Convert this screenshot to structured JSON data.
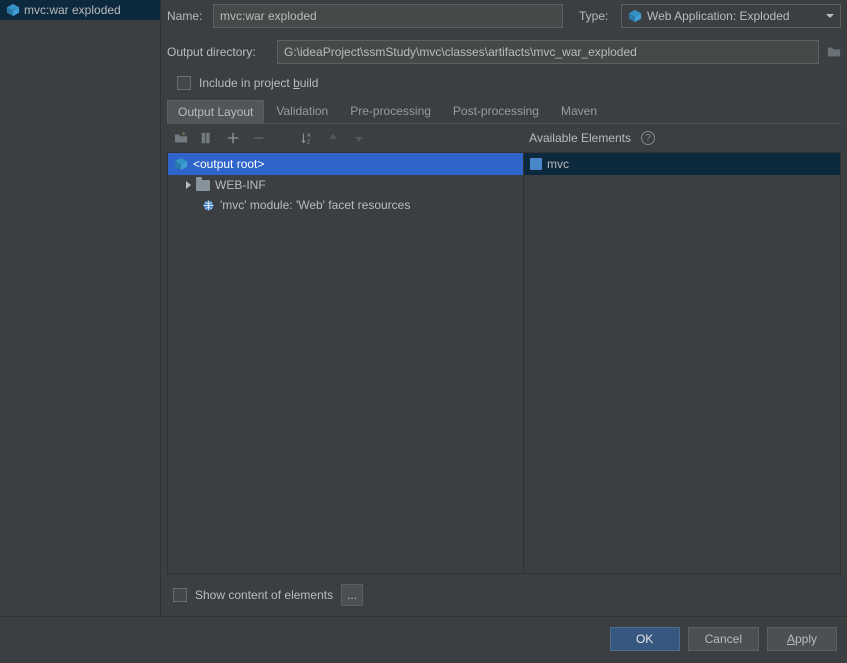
{
  "sidebar": {
    "artifact": "mvc:war exploded"
  },
  "form": {
    "name_label": "Name:",
    "name_value": "mvc:war exploded",
    "type_label": "Type:",
    "type_value": "Web Application: Exploded",
    "outdir_label": "Output directory:",
    "outdir_value": "G:\\ideaProject\\ssmStudy\\mvc\\classes\\artifacts\\mvc_war_exploded",
    "include_build_prefix": "Include in project ",
    "include_build_u": "b",
    "include_build_suffix": "uild"
  },
  "tabs": {
    "output_layout": "Output Layout",
    "validation": "Validation",
    "pre_processing": "Pre-processing",
    "post_processing": "Post-processing",
    "maven": "Maven"
  },
  "toolbar": {
    "available_label": "Available Elements"
  },
  "tree": {
    "root": "<output root>",
    "webinf": "WEB-INF",
    "web_facet": "'mvc' module: 'Web' facet resources"
  },
  "avail": {
    "mvc": "mvc"
  },
  "bottom": {
    "show_content": "Show content of elements",
    "dots": "..."
  },
  "buttons": {
    "ok": "OK",
    "cancel": "Cancel",
    "apply_u": "A",
    "apply_rest": "pply"
  }
}
